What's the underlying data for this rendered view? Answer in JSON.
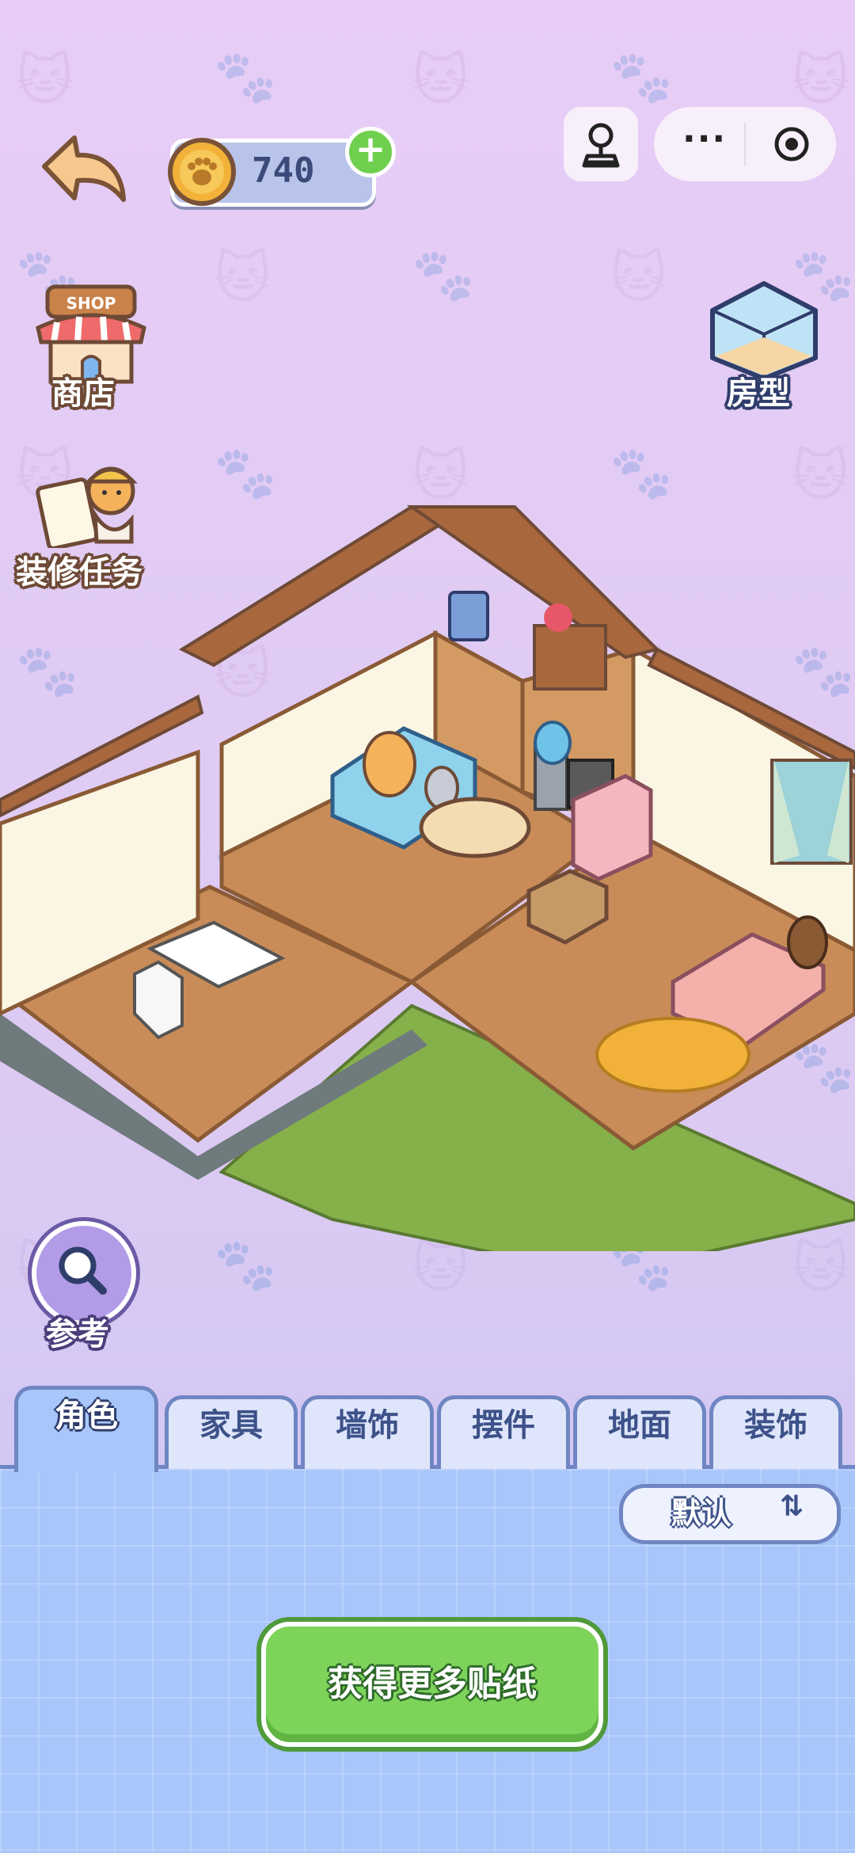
{
  "hud": {
    "coins": "740",
    "add_coin_symbol": "+",
    "more_symbol": "···"
  },
  "side_buttons": {
    "shop_sign": "SHOP",
    "shop_label": "商店",
    "task_label": "装修任务",
    "room_type_label": "房型",
    "reference_label": "参考"
  },
  "tabs": [
    {
      "label": "角色",
      "active": true
    },
    {
      "label": "家具",
      "active": false
    },
    {
      "label": "墙饰",
      "active": false
    },
    {
      "label": "摆件",
      "active": false
    },
    {
      "label": "地面",
      "active": false
    },
    {
      "label": "装饰",
      "active": false
    }
  ],
  "sort": {
    "label": "默认",
    "icon": "sort-arrows-icon"
  },
  "primary_action": {
    "label": "获得更多贴纸"
  },
  "colors": {
    "background": "#e7cdf6",
    "panel": "#a8c6fa",
    "accent_green": "#7ed35b",
    "wood": "#c98c58",
    "coin_gold": "#f2b23a"
  }
}
